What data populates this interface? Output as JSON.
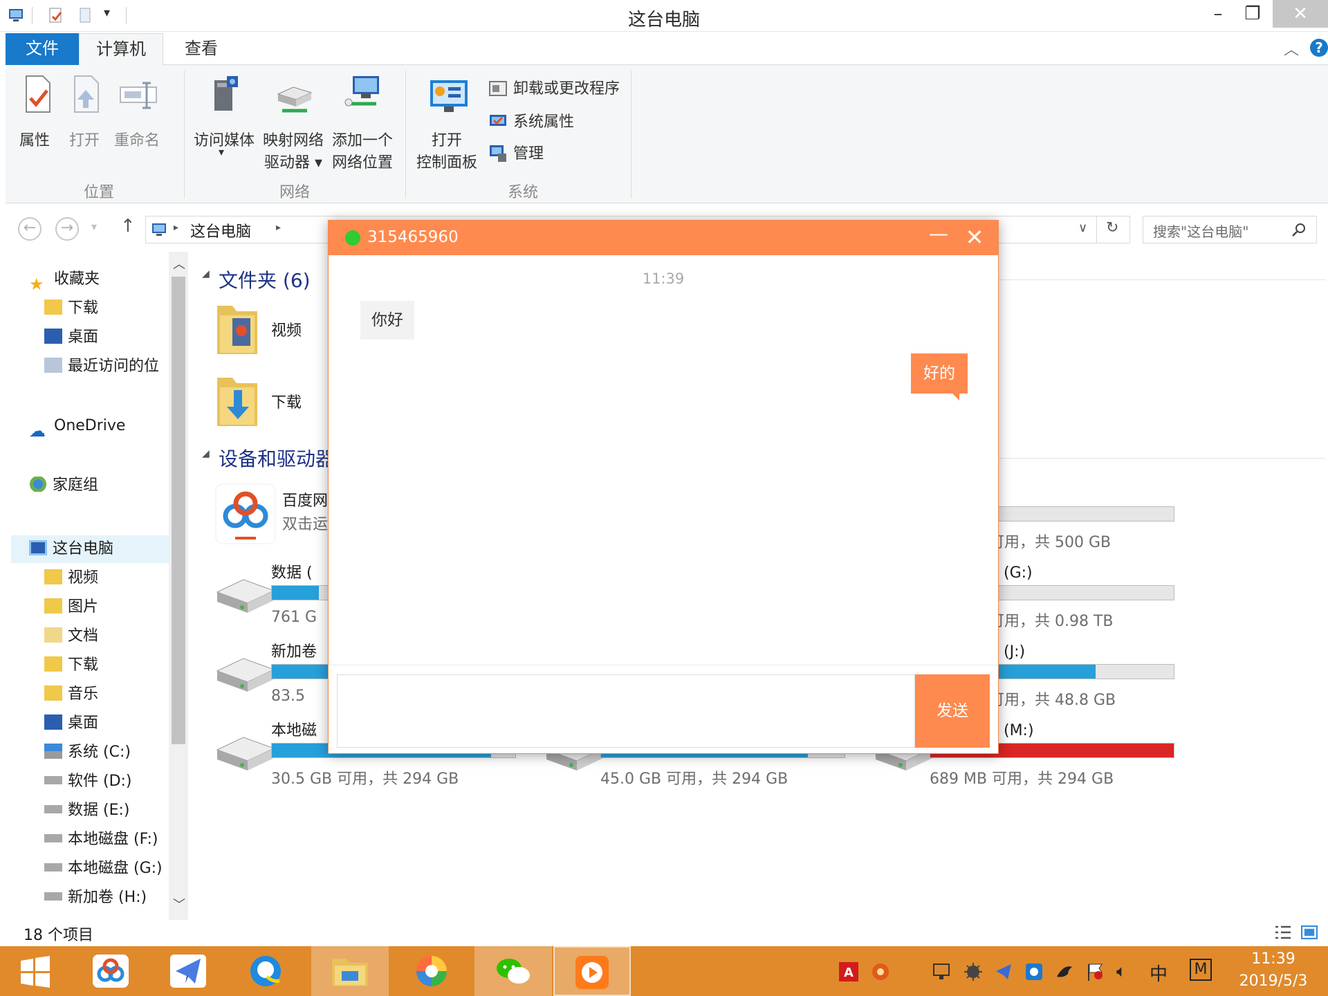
{
  "window": {
    "title": "这台电脑",
    "minimize": "–",
    "maximize": "❐",
    "close": "✕"
  },
  "ribbon": {
    "tabs": [
      {
        "label": "文件"
      },
      {
        "label": "计算机"
      },
      {
        "label": "查看"
      }
    ],
    "location_group": {
      "name": "位置",
      "properties": "属性",
      "open": "打开",
      "rename": "重命名"
    },
    "network_group": {
      "name": "网络",
      "access_media": "访问媒体",
      "map_drive_line1": "映射网络",
      "map_drive_line2": "驱动器 ▾",
      "add_location_line1": "添加一个",
      "add_location_line2": "网络位置"
    },
    "system_group": {
      "name": "系统",
      "open_cp_line1": "打开",
      "open_cp_line2": "控制面板",
      "uninstall": "卸载或更改程序",
      "system_properties": "系统属性",
      "manage": "管理"
    }
  },
  "address": {
    "path": "这台电脑",
    "search_placeholder": "搜索\"这台电脑\""
  },
  "nav": {
    "favorites": "收藏夹",
    "fav_items": [
      "下载",
      "桌面",
      "最近访问的位"
    ],
    "onedrive": "OneDrive",
    "homegroup": "家庭组",
    "this_pc": "这台电脑",
    "pc_items": [
      "视频",
      "图片",
      "文档",
      "下载",
      "音乐",
      "桌面",
      "系统 (C:)",
      "软件 (D:)",
      "数据 (E:)",
      "本地磁盘 (F:)",
      "本地磁盘 (G:)",
      "新加卷 (H:)"
    ]
  },
  "content": {
    "folders_title": "文件夹 (6)",
    "folders": [
      "视频",
      "下载"
    ],
    "devices_title": "设备和驱动器",
    "baidu_name": "百度网",
    "baidu_sub": "双击运",
    "drives_left": [
      {
        "name": "数据 (",
        "free": "761 G",
        "fill": 0.2
      },
      {
        "name": "新加卷",
        "free": "83.5",
        "fill": 0.72
      },
      {
        "name": "本地磁",
        "free": "30.5 GB 可用，共 294 GB",
        "fill": 0.9
      }
    ],
    "drives_mid": [
      {
        "free": "45.0 GB 可用，共 294 GB",
        "fill": 0.85
      }
    ],
    "drives_right": [
      {
        "name": ")",
        "free": "可用，共 500 GB",
        "fill": 0.0
      },
      {
        "name": "盘 (G:)",
        "free": "可用，共 0.98 TB",
        "fill": 0.0
      },
      {
        "name": "盘 (J:)",
        "free": "可用，共 48.8 GB",
        "fill": 0.68
      },
      {
        "name": "盘 (M:)",
        "free": "689 MB 可用，共 294 GB",
        "fill": 1.0
      }
    ]
  },
  "status": {
    "count": "18 个项目"
  },
  "chat": {
    "contact": "315465960",
    "time": "11:39",
    "incoming": "你好",
    "outgoing": "好的",
    "send": "发送",
    "minimize": "—",
    "close": "✕"
  },
  "taskbar": {
    "clock_time": "11:39",
    "clock_date": "2019/5/3",
    "ime": "中",
    "ime_mode": "M"
  },
  "colors": {
    "accent": "#1979ca",
    "chat_orange": "#fe8a4f",
    "taskbar": "#e08a2c",
    "drive_bar": "#26a0da",
    "drive_bar_full": "#da2626",
    "online": "#2ecc30"
  }
}
